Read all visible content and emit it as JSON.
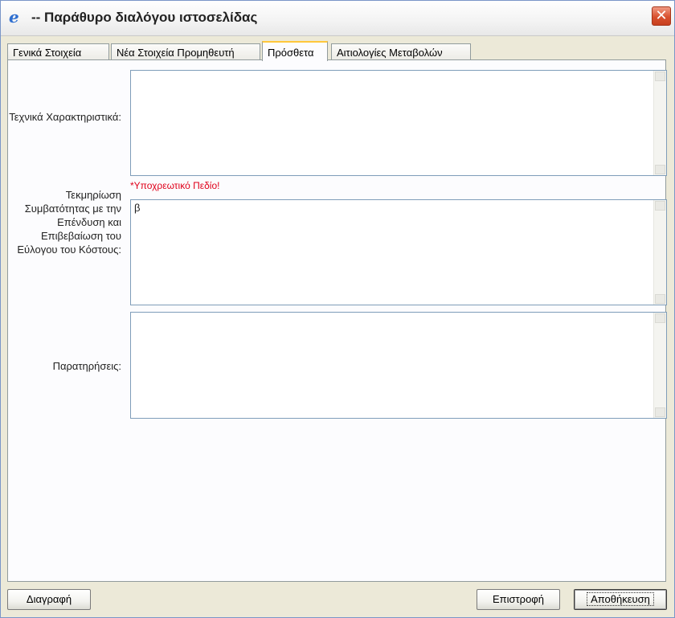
{
  "window": {
    "title": "-- Παράθυρο διαλόγου ιστοσελίδας",
    "close_symbol": "✕",
    "icon": "ie-icon"
  },
  "tabs": [
    {
      "label": "Γενικά Στοιχεία",
      "active": false
    },
    {
      "label": "Νέα Στοιχεία Προμηθευτή",
      "active": false
    },
    {
      "label": "Πρόσθετα",
      "active": true
    },
    {
      "label": "Αιτιολογίες Μεταβολών",
      "active": false
    }
  ],
  "form": {
    "technical_label": "Τεχνικά Χαρακτηριστικά:",
    "technical_value": "",
    "required_message": "*Υποχρεωτικό Πεδίο!",
    "justification_label": "Τεκμηρίωση Συμβατότητας με την Επένδυση και Επιβεβαίωση του Εύλογου του Κόστους:",
    "justification_value": "β",
    "remarks_label": "Παρατηρήσεις:",
    "remarks_value": ""
  },
  "footer": {
    "delete_label": "Διαγραφή",
    "return_label": "Επιστροφή",
    "save_label": "Αποθήκευση"
  },
  "colors": {
    "required": "#e0001a",
    "active_tab_accent": "#ffc83c",
    "close_button": "#d9512f"
  }
}
